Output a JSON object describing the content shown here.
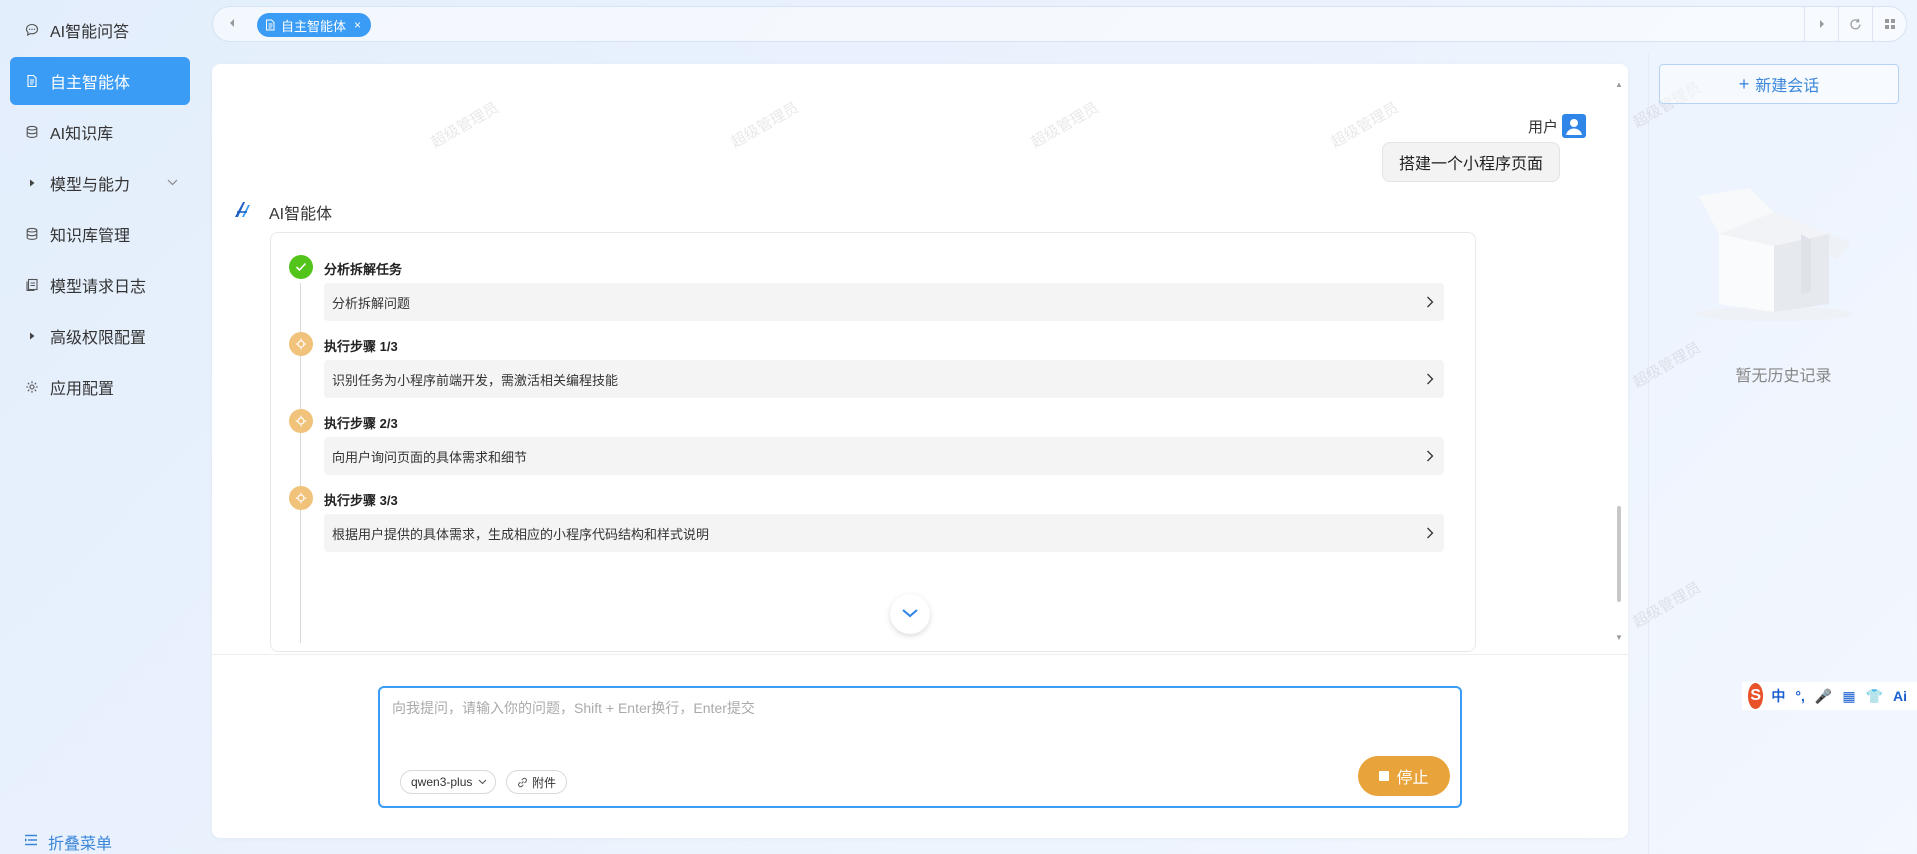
{
  "sidebar": {
    "items": [
      {
        "label": "AI智能问答",
        "icon": "chat-bubble-icon"
      },
      {
        "label": "自主智能体",
        "icon": "document-icon",
        "active": true
      },
      {
        "label": "AI知识库",
        "icon": "database-icon"
      },
      {
        "label": "模型与能力",
        "icon": "caret-right-icon",
        "expandable": true
      },
      {
        "label": "知识库管理",
        "icon": "database-icon"
      },
      {
        "label": "模型请求日志",
        "icon": "log-icon"
      },
      {
        "label": "高级权限配置",
        "icon": "caret-right-icon"
      },
      {
        "label": "应用配置",
        "icon": "gear-icon"
      }
    ],
    "collapse_label": "折叠菜单"
  },
  "tabs": {
    "active_label": "自主智能体",
    "close_symbol": "×"
  },
  "chat": {
    "user_name": "用户",
    "user_message": "搭建一个小程序页面",
    "ai_name": "AI智能体",
    "steps": [
      {
        "title": "分析拆解任务",
        "desc": "分析拆解问题",
        "status": "done"
      },
      {
        "title": "执行步骤 1/3",
        "desc": "识别任务为小程序前端开发，需激活相关编程技能",
        "status": "running"
      },
      {
        "title": "执行步骤 2/3",
        "desc": "向用户询问页面的具体需求和细节",
        "status": "running"
      },
      {
        "title": "执行步骤 3/3",
        "desc": "根据用户提供的具体需求，生成相应的小程序代码结构和样式说明",
        "status": "running"
      }
    ],
    "watermark": "超级管理员"
  },
  "input": {
    "placeholder": "向我提问，请输入你的问题，Shift + Enter换行，Enter提交",
    "model": "qwen3-plus",
    "attach_label": "附件",
    "stop_label": "停止"
  },
  "history": {
    "new_chat_label": "新建会话",
    "empty_label": "暂无历史记录"
  },
  "ime": {
    "logo": "S",
    "items": [
      "中",
      "°,",
      "🎤",
      "▦",
      "👕",
      "Ai"
    ]
  },
  "colors": {
    "accent": "#3b9cf5",
    "stop": "#e8a33a",
    "done": "#52c41a",
    "running": "#f0c27a"
  }
}
